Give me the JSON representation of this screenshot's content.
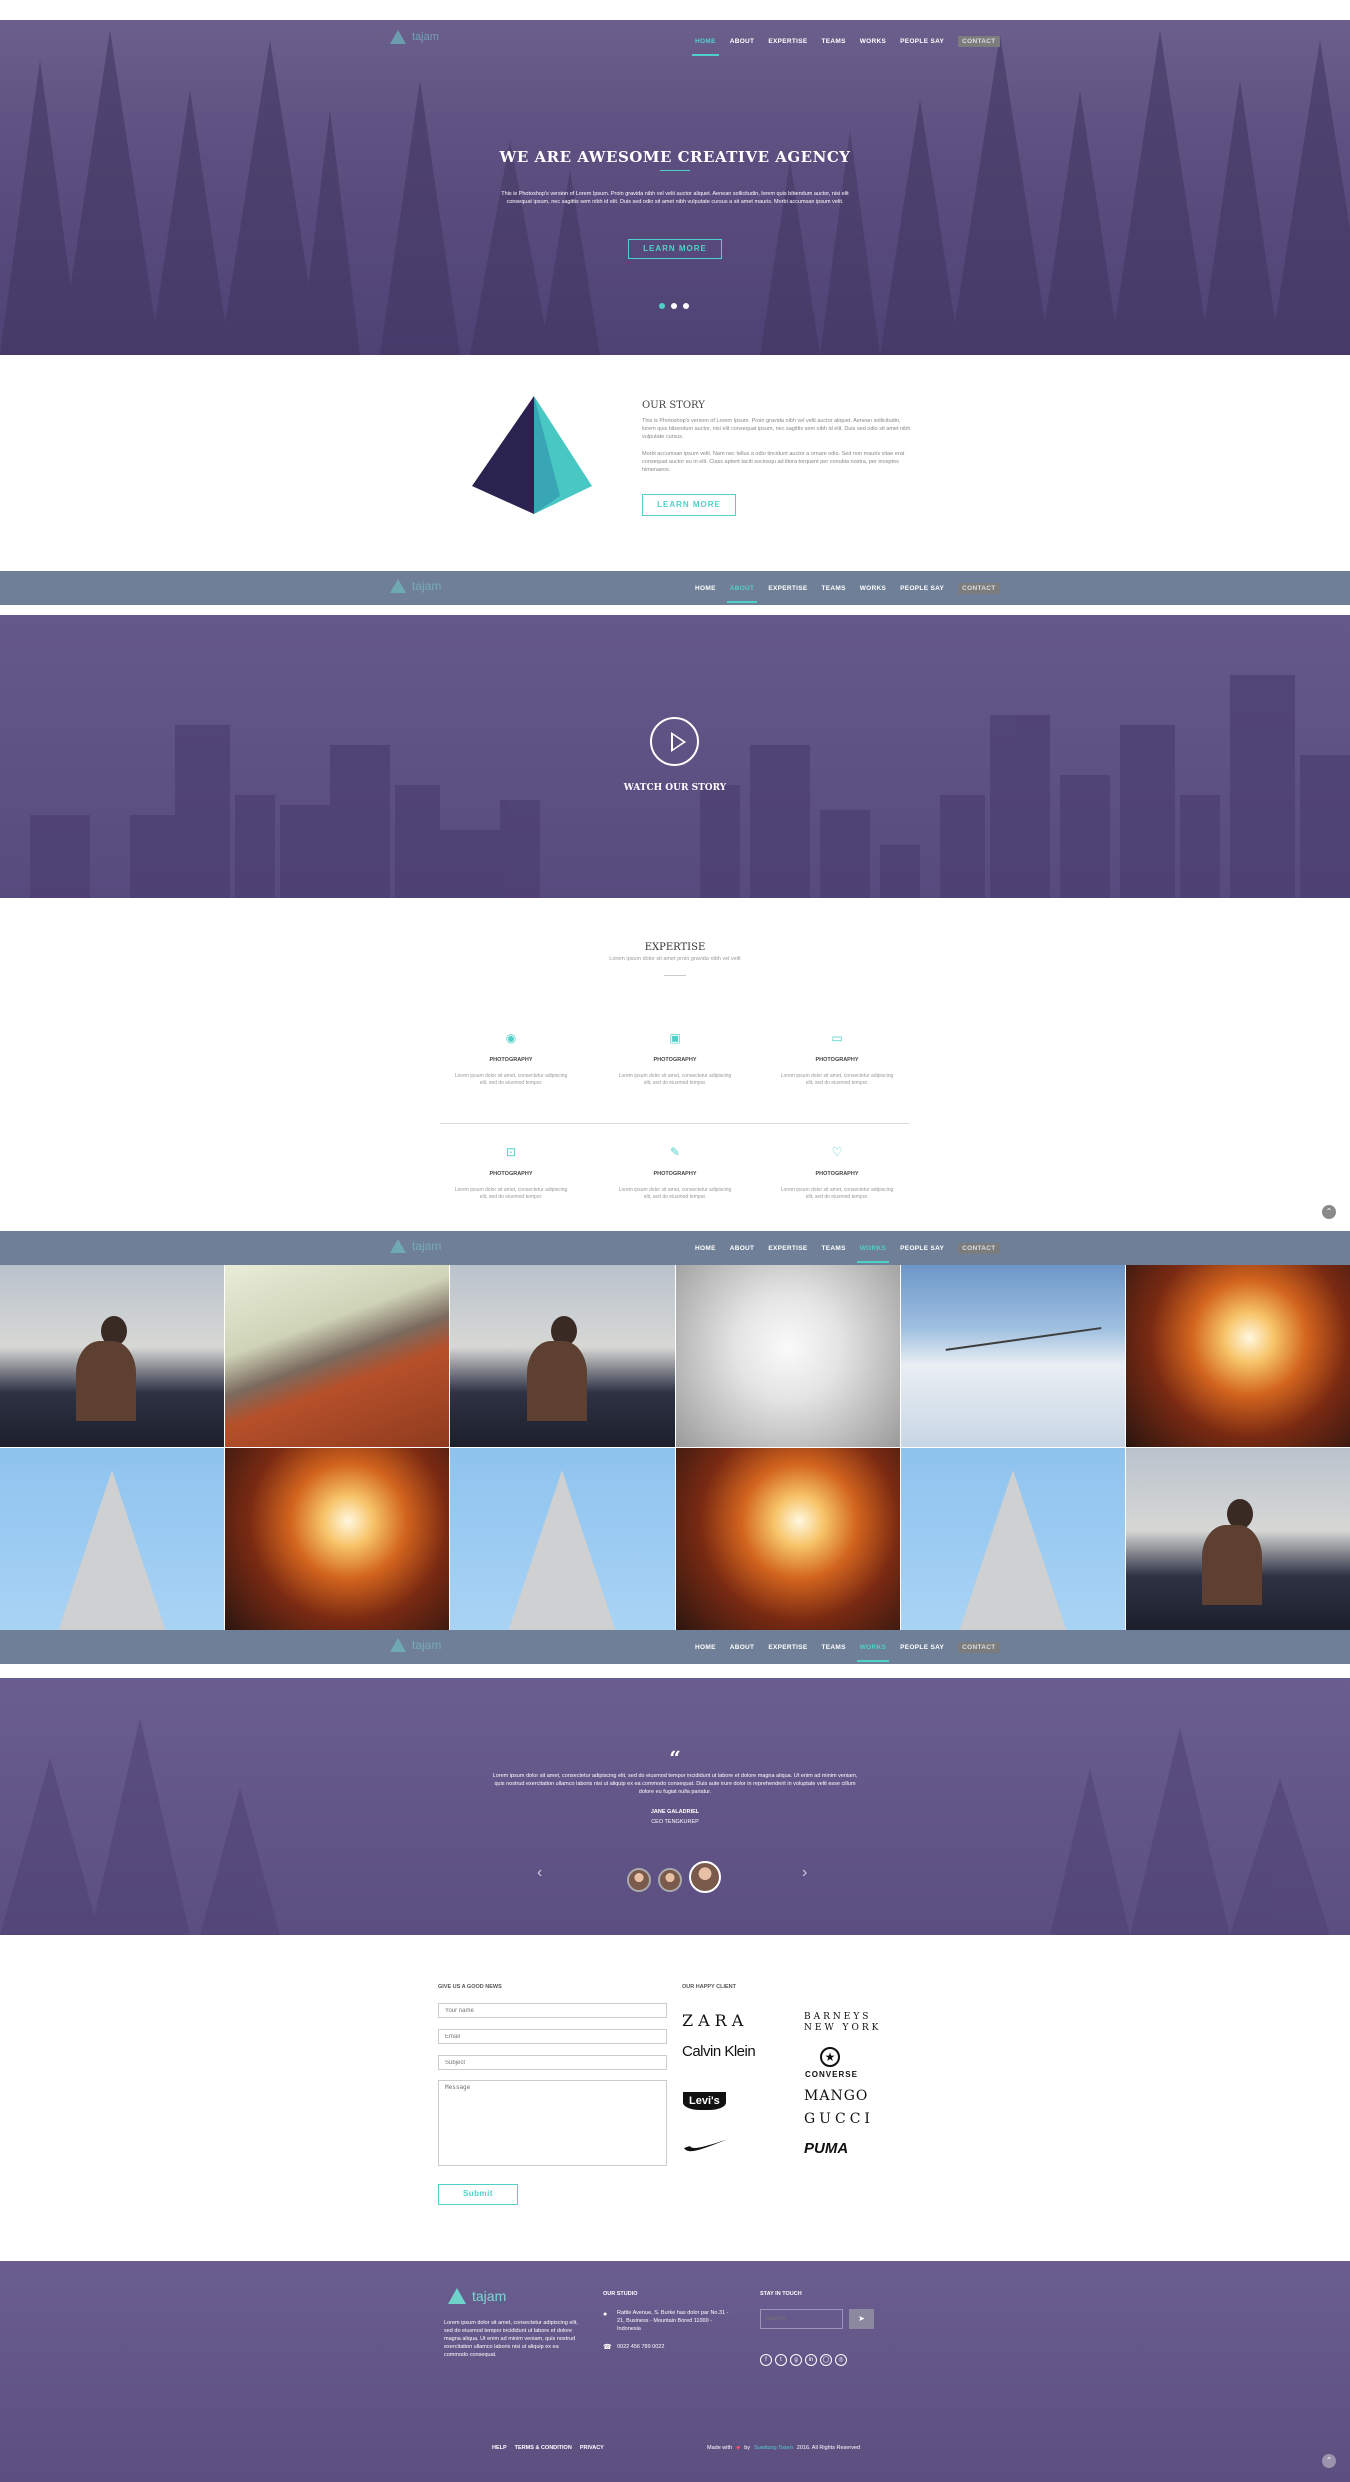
{
  "nav": {
    "logo": "tajam",
    "items": [
      "HOME",
      "ABOUT",
      "EXPERTISE",
      "TEAMS",
      "WORKS",
      "PEOPLE SAY",
      "CONTACT"
    ]
  },
  "hero": {
    "title": "WE ARE AWESOME CREATIVE AGENCY",
    "text": "This is Photoshop's version of Lorem Ipsum. Proin gravida nibh vel velit auctor aliquet. Aenean sollicitudin, lorem quis bibendum auctor, nisi elit consequat ipsum, nec sagittis sem nibh id elit. Duis sed odio sit amet nibh vulputate cursus a sit amet mauris. Morbi accumsan ipsum velit.",
    "button": "LEARN MORE"
  },
  "story": {
    "title": "OUR STORY",
    "p1": "This is Photoshop's version of Lorem Ipsum. Proin gravida nibh vel velit auctor aliquet. Aenean sollicitudin, lorem quis bibendum auctor, nisi elit consequat ipsum, nec sagittis sem nibh id elit. Duis sed odio sit amet nibh vulputate cursus.",
    "p2": "Morbi accumsan ipsum velit. Nam nec tellus a odio tincidunt auctor a ornare odio. Sed non mauris vitae erat consequat auctor eu in elit. Class aptent taciti sociosqu ad litora torquent per conubia nostra, per inceptos himenaeos.",
    "button": "LEARN MORE"
  },
  "video": {
    "title": "WATCH OUR STORY"
  },
  "expertise": {
    "title": "EXPERTISE",
    "subtitle": "Lorem ipsum dolor sit amet proin gravida nibh vel velit",
    "items": [
      {
        "icon": "camera-icon",
        "title": "PHOTOGRAPHY",
        "text": "Lorem ipsum dolor sit amet, consectetur adipiscing elit, sed do eiusmod tempor."
      },
      {
        "icon": "image-icon",
        "title": "PHOTOGRAPHY",
        "text": "Lorem ipsum dolor sit amet, consectetur adipiscing elit, sed do eiusmod tempor."
      },
      {
        "icon": "monitor-icon",
        "title": "PHOTOGRAPHY",
        "text": "Lorem ipsum dolor sit amet, consectetur adipiscing elit, sed do eiusmod tempor."
      },
      {
        "icon": "crop-icon",
        "title": "PHOTOGRAPHY",
        "text": "Lorem ipsum dolor sit amet, consectetur adipiscing elit, sed do eiusmod tempor."
      },
      {
        "icon": "brush-icon",
        "title": "PHOTOGRAPHY",
        "text": "Lorem ipsum dolor sit amet, consectetur adipiscing elit, sed do eiusmod tempor."
      },
      {
        "icon": "heart-icon",
        "title": "PHOTOGRAPHY",
        "text": "Lorem ipsum dolor sit amet, consectetur adipiscing elit, sed do eiusmod tempor."
      }
    ]
  },
  "testimonial": {
    "quote_mark": "“",
    "text": "Lorem ipsum dolor sit amet, consectetur adipiscing elit, sed do eiusmod tempor incididunt ut labore et dolore magna aliqua. Ut enim ad minim veniam, quis nostrud exercitation ullamco laboris nisi ut aliquip ex ea commodo consequat. Duis aute irure dolor in reprehenderit in voluptate velit esse cillum dolore eu fugiat nulla pariatur.",
    "name": "JANE GALADRIEL",
    "role": "CEO TENGKUREP"
  },
  "contact": {
    "form_title": "GIVE US A GOOD NEWS",
    "name_placeholder": "Your name",
    "email_placeholder": "Email",
    "subject_placeholder": "Subject",
    "message_placeholder": "Message",
    "submit": "Submit",
    "clients_title": "OUR HAPPY CLIENT",
    "brands": [
      "ZARA",
      "BARNEYS",
      "NEW YORK",
      "Calvin Klein",
      "CONVERSE",
      "Levi's",
      "MANGO",
      "GUCCI",
      "PUMA"
    ]
  },
  "footer": {
    "logo": "tajam",
    "about": "Lorem ipsum dolor sit amet, consectetur adipiscing elit, sed do eiusmod tempor incididunt ut labore et dolore magna aliqua. Ut enim ad minim veniam, quis nostrud exercitation ullamco laboris nisi ut aliquip ex ea commodo consequat.",
    "studio_title": "OUR STUDIO",
    "address": "Rattle Avenue, S. Burke has dolor par No.31 - 21, Business - Mountain Bored 11000 - Indonesia",
    "phone": "0022 456 789 0022",
    "stay_title": "STAY IN TOUCH",
    "search_placeholder": "Search",
    "links": [
      "HELP",
      "TERMS & CONDITION",
      "PRIVACY"
    ],
    "made_with": "Made with",
    "by": "by",
    "author": "Suwitung Tosen",
    "rights": "2016. All Rights Reserved"
  },
  "colors": {
    "accent": "#4fd1c9",
    "purple": "#5d4f80",
    "navbar": "#6f7f97"
  }
}
